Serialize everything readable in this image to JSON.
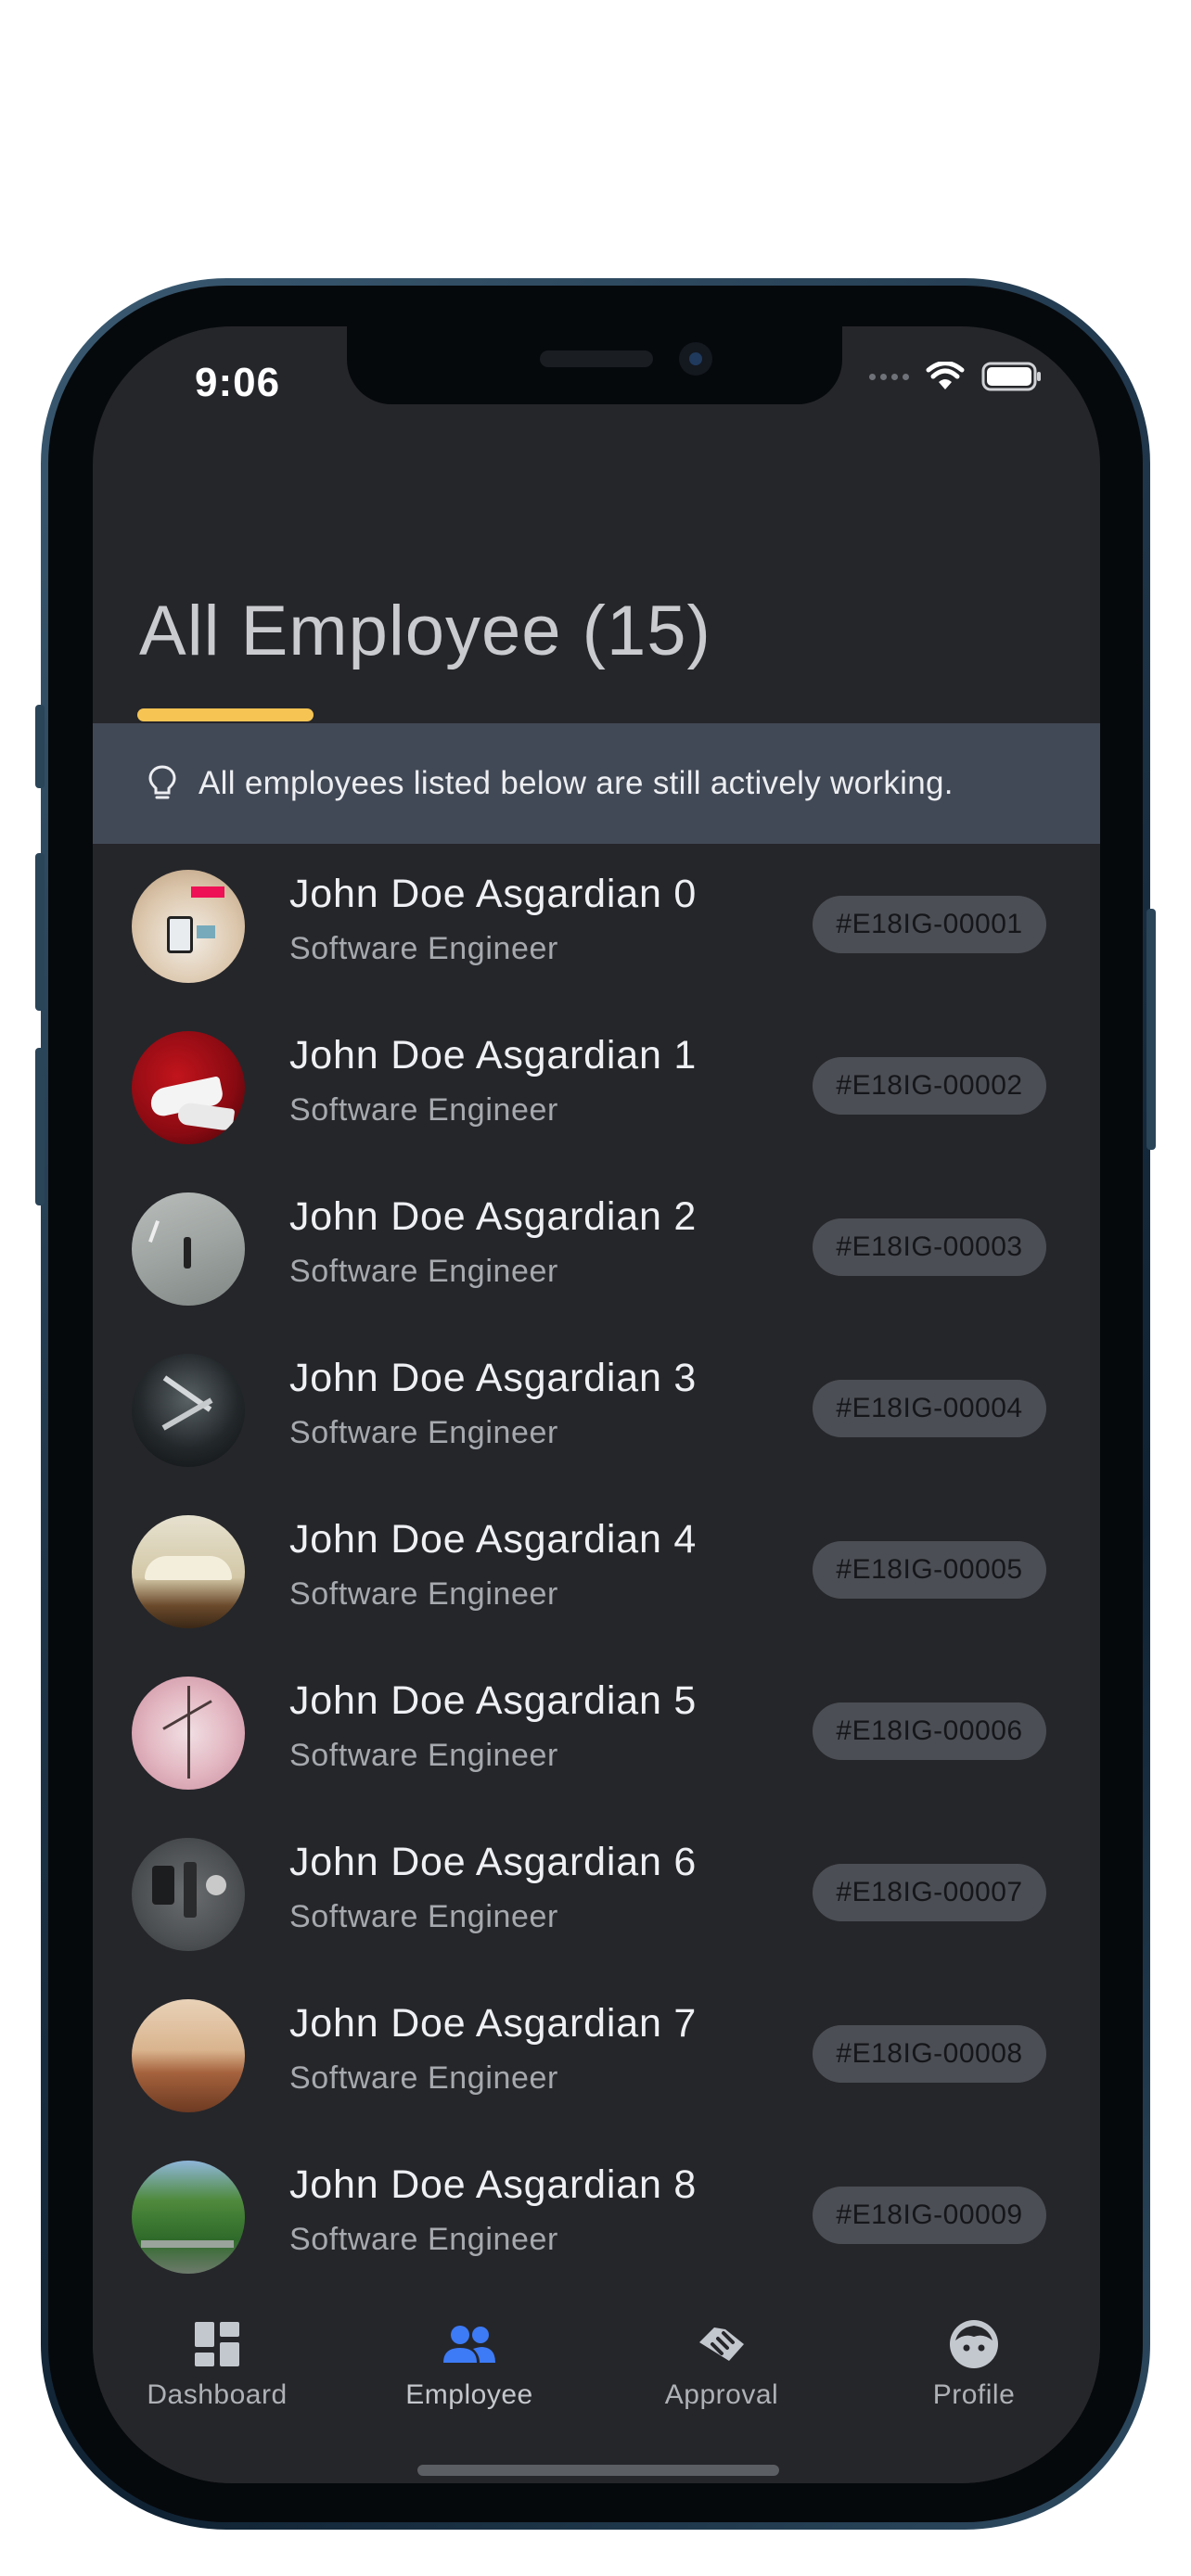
{
  "status": {
    "time": "9:06"
  },
  "header": {
    "title": "All Employee (15)"
  },
  "notice": {
    "icon": "lightbulb-icon",
    "text": "All employees listed below are still actively working."
  },
  "employees": [
    {
      "name": "John Doe Asgardian 0",
      "role": "Software Engineer",
      "id": "#E18IG-00001"
    },
    {
      "name": "John Doe Asgardian 1",
      "role": "Software Engineer",
      "id": "#E18IG-00002"
    },
    {
      "name": "John Doe Asgardian 2",
      "role": "Software Engineer",
      "id": "#E18IG-00003"
    },
    {
      "name": "John Doe Asgardian 3",
      "role": "Software Engineer",
      "id": "#E18IG-00004"
    },
    {
      "name": "John Doe Asgardian 4",
      "role": "Software Engineer",
      "id": "#E18IG-00005"
    },
    {
      "name": "John Doe Asgardian 5",
      "role": "Software Engineer",
      "id": "#E18IG-00006"
    },
    {
      "name": "John Doe Asgardian 6",
      "role": "Software Engineer",
      "id": "#E18IG-00007"
    },
    {
      "name": "John Doe Asgardian 7",
      "role": "Software Engineer",
      "id": "#E18IG-00008"
    },
    {
      "name": "John Doe Asgardian 8",
      "role": "Software Engineer",
      "id": "#E18IG-00009"
    }
  ],
  "nav": {
    "items": [
      {
        "label": "Dashboard",
        "icon": "dashboard-icon"
      },
      {
        "label": "Employee",
        "icon": "people-icon",
        "active": true
      },
      {
        "label": "Approval",
        "icon": "handshake-icon"
      },
      {
        "label": "Profile",
        "icon": "face-icon"
      }
    ]
  },
  "colors": {
    "background": "#25262a",
    "accent_underline": "#f5c453",
    "active_nav": "#3d7af5",
    "notice_bg": "#424956",
    "badge_bg": "#4b4e54"
  }
}
